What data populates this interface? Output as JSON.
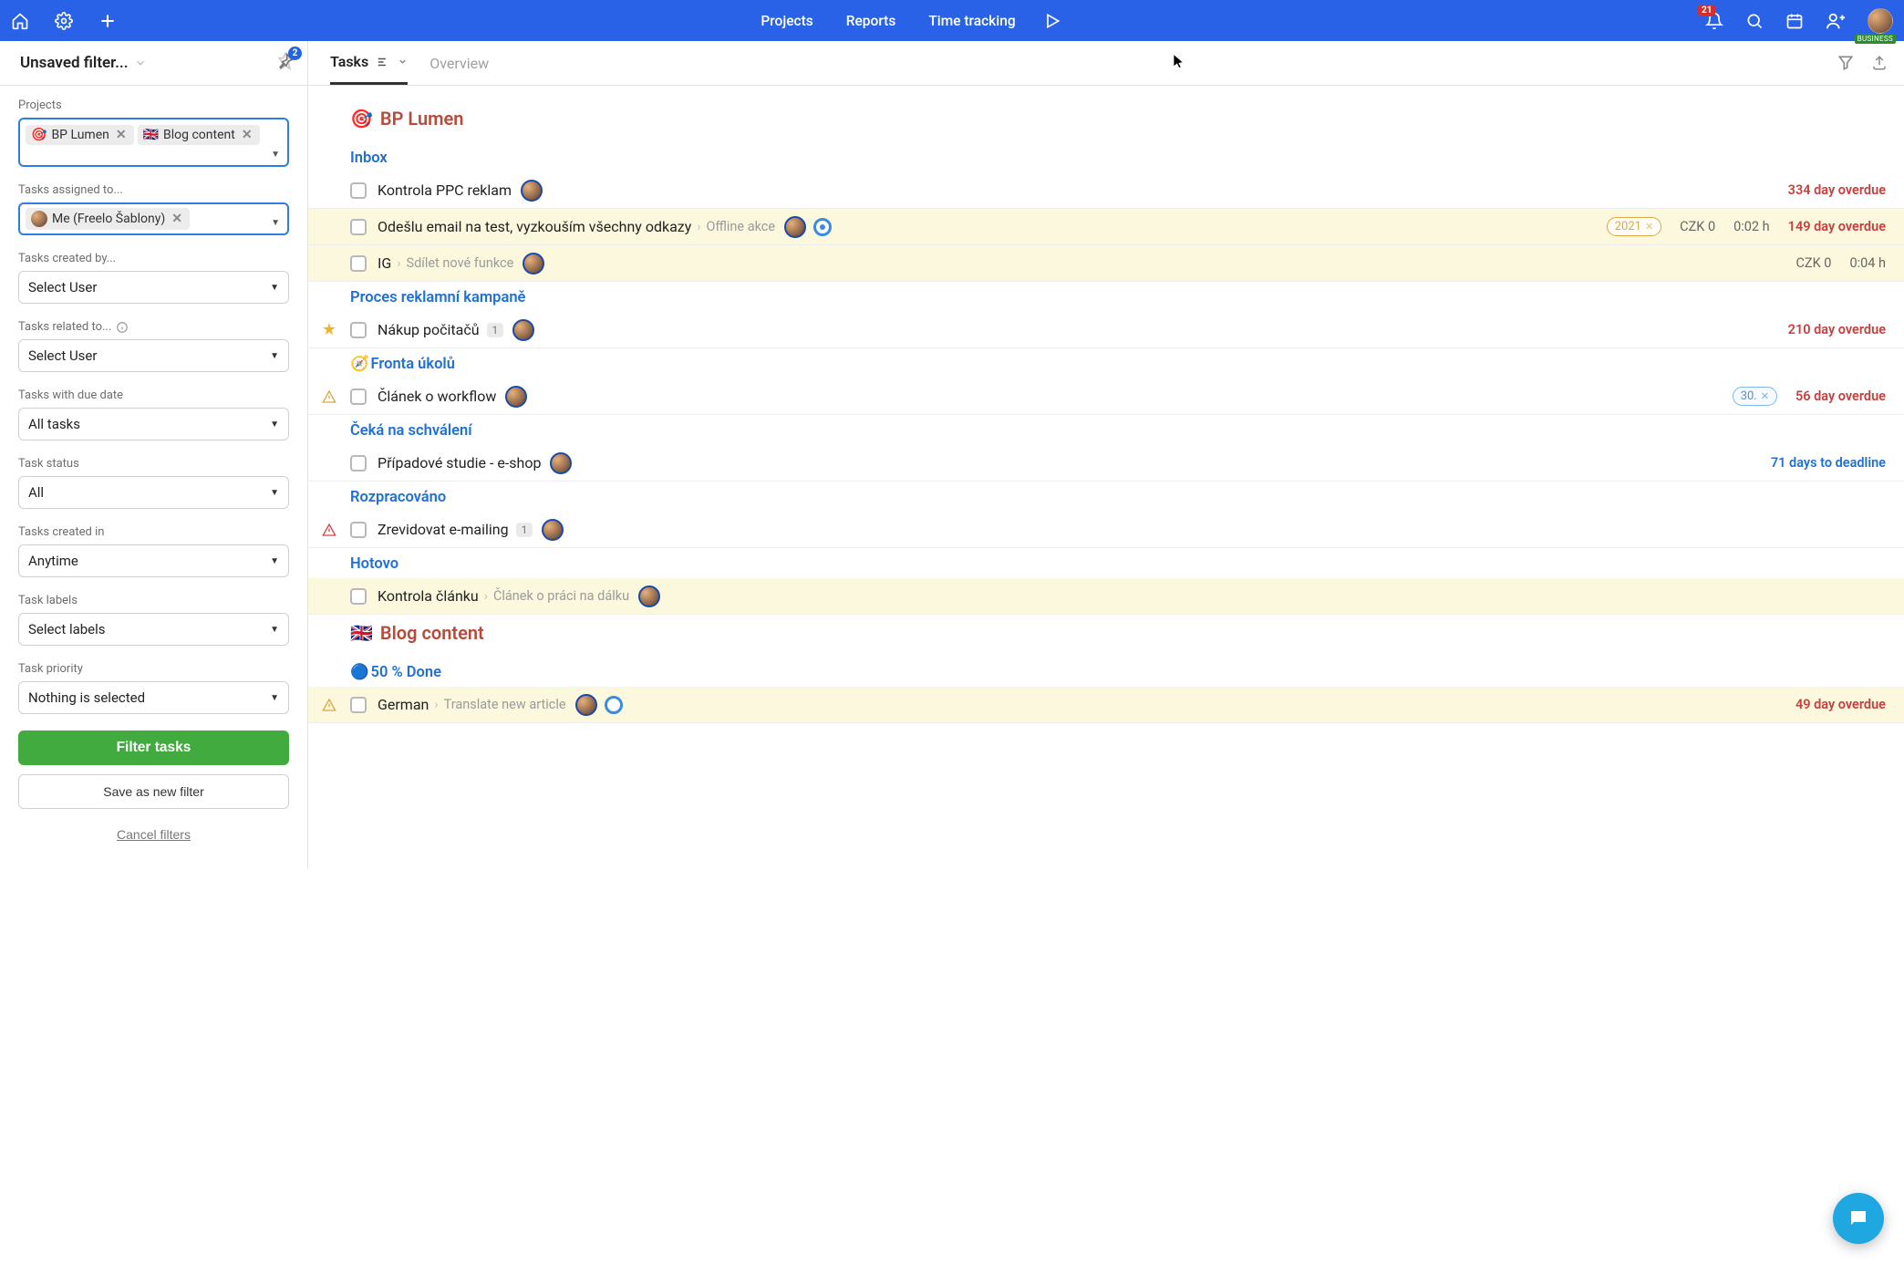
{
  "topbar": {
    "nav": {
      "projects": "Projects",
      "reports": "Reports",
      "timetracking": "Time tracking"
    },
    "notif_count": "21",
    "business_badge": "BUSINESS"
  },
  "secondbar": {
    "title": "Unsaved filter...",
    "pin_count": "2",
    "tabs": {
      "tasks": "Tasks",
      "overview": "Overview"
    }
  },
  "filters": {
    "projects_label": "Projects",
    "project_tags": [
      {
        "emoji": "🎯",
        "name": "BP Lumen"
      },
      {
        "emoji": "🇬🇧",
        "name": "Blog content"
      }
    ],
    "assigned_label": "Tasks assigned to...",
    "assigned_value": "Me (Freelo Šablony)",
    "created_by_label": "Tasks created by...",
    "select_user": "Select User",
    "related_to_label": "Tasks related to...",
    "due_date_label": "Tasks with due date",
    "due_date_value": "All tasks",
    "status_label": "Task status",
    "status_value": "All",
    "created_in_label": "Tasks created in",
    "created_in_value": "Anytime",
    "labels_label": "Task labels",
    "labels_value": "Select labels",
    "priority_label": "Task priority",
    "priority_value": "Nothing is selected",
    "filter_btn": "Filter tasks",
    "save_btn": "Save as new filter",
    "cancel_btn": "Cancel filters"
  },
  "projects": [
    {
      "emoji": "🎯",
      "name": "BP Lumen",
      "sections": [
        {
          "name": "Inbox",
          "tasks": [
            {
              "title": "Kontrola PPC reklam",
              "overdue": "334 day overdue",
              "highlight": false
            },
            {
              "title": "Odešlu email na test, vyzkouším všechny odkazy",
              "crumb": "Offline akce",
              "pill": "2021",
              "money": "CZK 0",
              "time": "0:02 h",
              "overdue": "149 day overdue",
              "highlight": true,
              "circle": true
            },
            {
              "title": "IG",
              "crumb": "Sdílet nové funkce",
              "money": "CZK 0",
              "time": "0:04 h",
              "highlight": true
            }
          ]
        },
        {
          "name": "Proces reklamní kampaně",
          "tasks": [
            {
              "title": "Nákup počitačů",
              "count": "1",
              "overdue": "210 day overdue",
              "gutter_star": true
            }
          ]
        },
        {
          "name": "Fronta úkolů",
          "emoji": "🧭",
          "tasks": [
            {
              "title": "Článek o workflow",
              "pill_blue": "30.",
              "overdue": "56 day overdue",
              "gutter_warn": "yellow"
            }
          ]
        },
        {
          "name": "Čeká na schválení",
          "tasks": [
            {
              "title": "Případové studie - e-shop",
              "deadline": "71 days to deadline"
            }
          ]
        },
        {
          "name": "Rozpracováno",
          "tasks": [
            {
              "title": "Zrevidovat e-mailing",
              "count": "1",
              "gutter_warn": "red"
            }
          ]
        },
        {
          "name": "Hotovo",
          "tasks": [
            {
              "title": "Kontrola článku",
              "crumb": "Článek o práci na dálku",
              "highlight": true
            }
          ]
        }
      ]
    },
    {
      "emoji": "🇬🇧",
      "name": "Blog content",
      "sections": [
        {
          "name": "50 % Done",
          "emoji": "🔵",
          "tasks": [
            {
              "title": "German",
              "crumb": "Translate new article",
              "overdue": "49 day overdue",
              "highlight": true,
              "circle_open": true,
              "gutter_warn": "yellow"
            }
          ]
        }
      ]
    }
  ]
}
